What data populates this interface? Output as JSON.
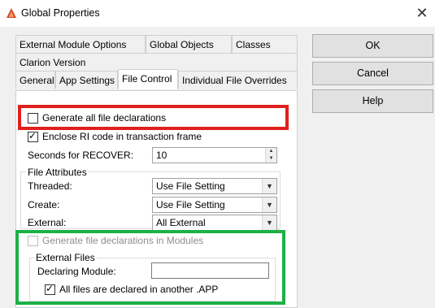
{
  "window": {
    "title": "Global Properties"
  },
  "tabs_row1": [
    {
      "label": "External Module Options"
    },
    {
      "label": "Global Objects"
    },
    {
      "label": "Classes"
    }
  ],
  "tabs_row2": [
    {
      "label": "Clarion Version"
    }
  ],
  "tabs_row3": [
    {
      "label": "General"
    },
    {
      "label": "App Settings"
    },
    {
      "label": "File Control"
    },
    {
      "label": "Individual File Overrides"
    }
  ],
  "options": {
    "generate_all": {
      "label": "Generate all file declarations",
      "checked": false
    },
    "enclose_ri": {
      "label": "Enclose RI code in transaction frame",
      "checked": true
    },
    "seconds_label": "Seconds for RECOVER:",
    "seconds_value": "10"
  },
  "file_attributes": {
    "title": "File Attributes",
    "threaded_label": "Threaded:",
    "threaded_value": "Use File Setting",
    "create_label": "Create:",
    "create_value": "Use File Setting",
    "external_label": "External:",
    "external_value": "All External"
  },
  "modules": {
    "generate_in_modules": {
      "label": "Generate file declarations in Modules",
      "checked": false
    },
    "external_files_title": "External Files",
    "declaring_module_label": "Declaring Module:",
    "declaring_module_value": "",
    "all_files_declared": {
      "label": "All files are declared in another .APP",
      "checked": true
    }
  },
  "buttons": {
    "ok": "OK",
    "cancel": "Cancel",
    "help": "Help"
  },
  "colors": {
    "highlight_red": "#e0201c",
    "highlight_green": "#1db046"
  }
}
